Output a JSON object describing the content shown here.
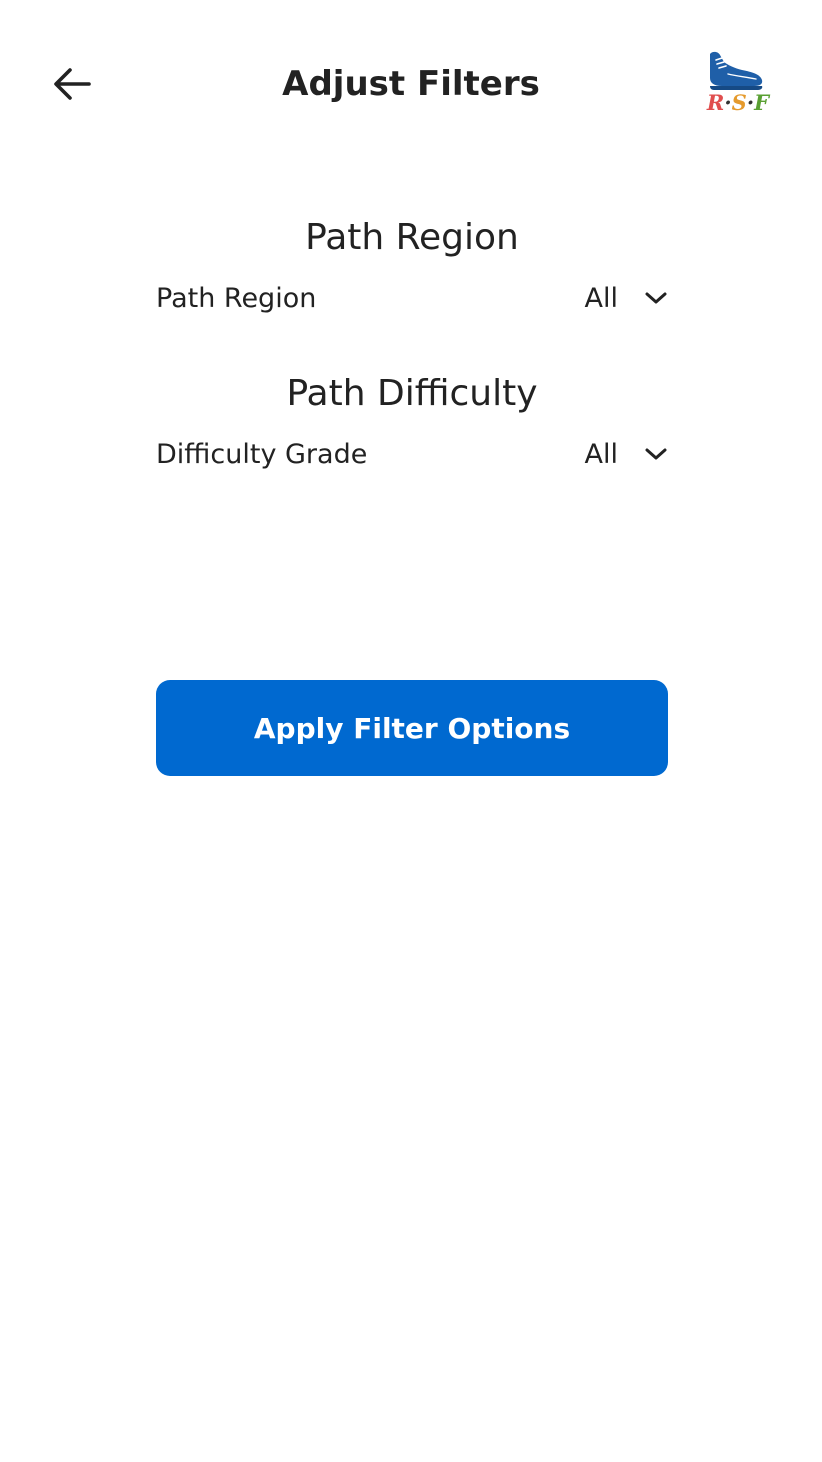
{
  "header": {
    "title": "Adjust Filters",
    "back_icon": "arrow-left-icon",
    "logo": {
      "icon": "running-shoe-icon",
      "letters": [
        {
          "char": "R",
          "color": "#e04e4e"
        },
        {
          "char": "·",
          "color": "#333333"
        },
        {
          "char": "S",
          "color": "#e59a2c"
        },
        {
          "char": "·",
          "color": "#333333"
        },
        {
          "char": "F",
          "color": "#5aa033"
        }
      ],
      "shoe_color": "#1f5fa8"
    }
  },
  "filters": {
    "region": {
      "heading": "Path Region",
      "label": "Path Region",
      "value": "All",
      "icon": "chevron-down-icon"
    },
    "difficulty": {
      "heading": "Path Difficulty",
      "label": "Difficulty Grade",
      "value": "All",
      "icon": "chevron-down-icon"
    }
  },
  "actions": {
    "apply_label": "Apply Filter Options",
    "apply_color": "#0069d0"
  }
}
